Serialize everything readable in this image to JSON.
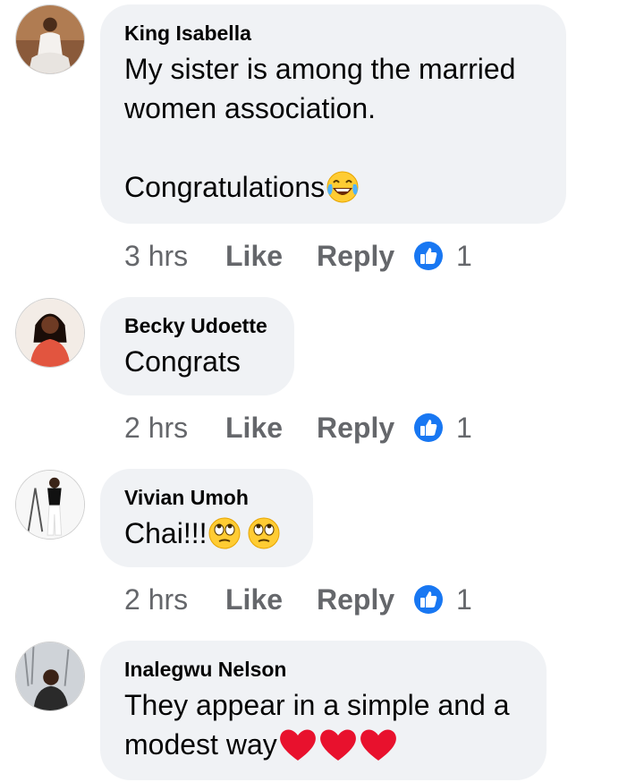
{
  "comments": [
    {
      "author": "King Isabella",
      "text": "My sister is among the married\nwomen association.\n\nCongratulations",
      "emoji": [
        "face-with-tears-of-joy-emoji"
      ],
      "time": "3 hrs",
      "like_label": "Like",
      "reply_label": "Reply",
      "reaction_icon": "thumbs-up-icon",
      "reaction_count": "1"
    },
    {
      "author": "Becky Udoette",
      "text": "Congrats",
      "emoji": [],
      "time": "2 hrs",
      "like_label": "Like",
      "reply_label": "Reply",
      "reaction_icon": "thumbs-up-icon",
      "reaction_count": "1"
    },
    {
      "author": "Vivian Umoh",
      "text": "Chai!!!",
      "emoji": [
        "rolling-eyes-emoji",
        "rolling-eyes-emoji"
      ],
      "time": "2 hrs",
      "like_label": "Like",
      "reply_label": "Reply",
      "reaction_icon": "thumbs-up-icon",
      "reaction_count": "1"
    },
    {
      "author": "Inalegwu Nelson",
      "text": "They appear in a simple and a\nmodest way",
      "emoji": [
        "red-heart-emoji",
        "red-heart-emoji",
        "red-heart-emoji"
      ],
      "time": "",
      "like_label": "",
      "reply_label": "",
      "reaction_icon": "",
      "reaction_count": ""
    }
  ],
  "colors": {
    "bubble_bg": "#f0f2f5",
    "secondary_text": "#65676b",
    "like_blue": "#1877f2",
    "heart_red": "#e8112d"
  }
}
